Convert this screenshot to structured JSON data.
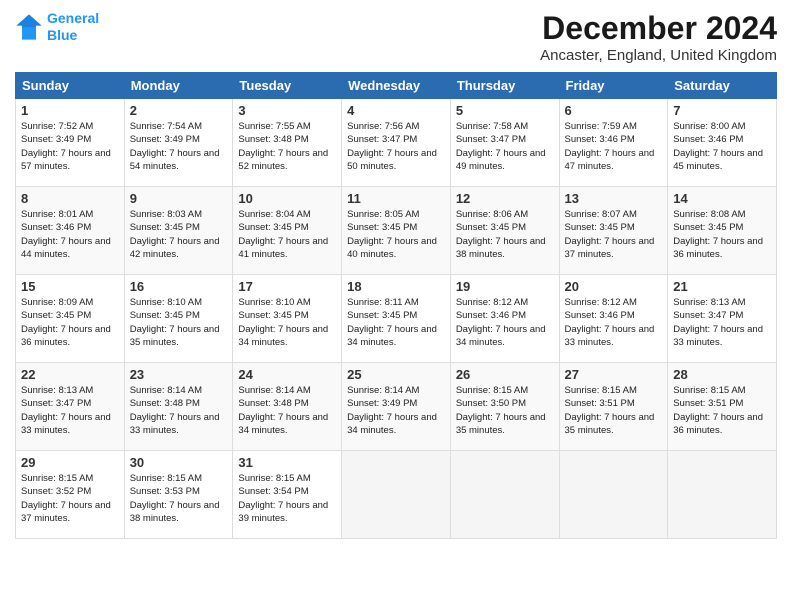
{
  "header": {
    "logo_line1": "General",
    "logo_line2": "Blue",
    "title": "December 2024",
    "subtitle": "Ancaster, England, United Kingdom"
  },
  "weekdays": [
    "Sunday",
    "Monday",
    "Tuesday",
    "Wednesday",
    "Thursday",
    "Friday",
    "Saturday"
  ],
  "weeks": [
    [
      {
        "day": "1",
        "sunrise": "7:52 AM",
        "sunset": "3:49 PM",
        "daylight": "7 hours and 57 minutes."
      },
      {
        "day": "2",
        "sunrise": "7:54 AM",
        "sunset": "3:49 PM",
        "daylight": "7 hours and 54 minutes."
      },
      {
        "day": "3",
        "sunrise": "7:55 AM",
        "sunset": "3:48 PM",
        "daylight": "7 hours and 52 minutes."
      },
      {
        "day": "4",
        "sunrise": "7:56 AM",
        "sunset": "3:47 PM",
        "daylight": "7 hours and 50 minutes."
      },
      {
        "day": "5",
        "sunrise": "7:58 AM",
        "sunset": "3:47 PM",
        "daylight": "7 hours and 49 minutes."
      },
      {
        "day": "6",
        "sunrise": "7:59 AM",
        "sunset": "3:46 PM",
        "daylight": "7 hours and 47 minutes."
      },
      {
        "day": "7",
        "sunrise": "8:00 AM",
        "sunset": "3:46 PM",
        "daylight": "7 hours and 45 minutes."
      }
    ],
    [
      {
        "day": "8",
        "sunrise": "8:01 AM",
        "sunset": "3:46 PM",
        "daylight": "7 hours and 44 minutes."
      },
      {
        "day": "9",
        "sunrise": "8:03 AM",
        "sunset": "3:45 PM",
        "daylight": "7 hours and 42 minutes."
      },
      {
        "day": "10",
        "sunrise": "8:04 AM",
        "sunset": "3:45 PM",
        "daylight": "7 hours and 41 minutes."
      },
      {
        "day": "11",
        "sunrise": "8:05 AM",
        "sunset": "3:45 PM",
        "daylight": "7 hours and 40 minutes."
      },
      {
        "day": "12",
        "sunrise": "8:06 AM",
        "sunset": "3:45 PM",
        "daylight": "7 hours and 38 minutes."
      },
      {
        "day": "13",
        "sunrise": "8:07 AM",
        "sunset": "3:45 PM",
        "daylight": "7 hours and 37 minutes."
      },
      {
        "day": "14",
        "sunrise": "8:08 AM",
        "sunset": "3:45 PM",
        "daylight": "7 hours and 36 minutes."
      }
    ],
    [
      {
        "day": "15",
        "sunrise": "8:09 AM",
        "sunset": "3:45 PM",
        "daylight": "7 hours and 36 minutes."
      },
      {
        "day": "16",
        "sunrise": "8:10 AM",
        "sunset": "3:45 PM",
        "daylight": "7 hours and 35 minutes."
      },
      {
        "day": "17",
        "sunrise": "8:10 AM",
        "sunset": "3:45 PM",
        "daylight": "7 hours and 34 minutes."
      },
      {
        "day": "18",
        "sunrise": "8:11 AM",
        "sunset": "3:45 PM",
        "daylight": "7 hours and 34 minutes."
      },
      {
        "day": "19",
        "sunrise": "8:12 AM",
        "sunset": "3:46 PM",
        "daylight": "7 hours and 34 minutes."
      },
      {
        "day": "20",
        "sunrise": "8:12 AM",
        "sunset": "3:46 PM",
        "daylight": "7 hours and 33 minutes."
      },
      {
        "day": "21",
        "sunrise": "8:13 AM",
        "sunset": "3:47 PM",
        "daylight": "7 hours and 33 minutes."
      }
    ],
    [
      {
        "day": "22",
        "sunrise": "8:13 AM",
        "sunset": "3:47 PM",
        "daylight": "7 hours and 33 minutes."
      },
      {
        "day": "23",
        "sunrise": "8:14 AM",
        "sunset": "3:48 PM",
        "daylight": "7 hours and 33 minutes."
      },
      {
        "day": "24",
        "sunrise": "8:14 AM",
        "sunset": "3:48 PM",
        "daylight": "7 hours and 34 minutes."
      },
      {
        "day": "25",
        "sunrise": "8:14 AM",
        "sunset": "3:49 PM",
        "daylight": "7 hours and 34 minutes."
      },
      {
        "day": "26",
        "sunrise": "8:15 AM",
        "sunset": "3:50 PM",
        "daylight": "7 hours and 35 minutes."
      },
      {
        "day": "27",
        "sunrise": "8:15 AM",
        "sunset": "3:51 PM",
        "daylight": "7 hours and 35 minutes."
      },
      {
        "day": "28",
        "sunrise": "8:15 AM",
        "sunset": "3:51 PM",
        "daylight": "7 hours and 36 minutes."
      }
    ],
    [
      {
        "day": "29",
        "sunrise": "8:15 AM",
        "sunset": "3:52 PM",
        "daylight": "7 hours and 37 minutes."
      },
      {
        "day": "30",
        "sunrise": "8:15 AM",
        "sunset": "3:53 PM",
        "daylight": "7 hours and 38 minutes."
      },
      {
        "day": "31",
        "sunrise": "8:15 AM",
        "sunset": "3:54 PM",
        "daylight": "7 hours and 39 minutes."
      },
      null,
      null,
      null,
      null
    ]
  ]
}
